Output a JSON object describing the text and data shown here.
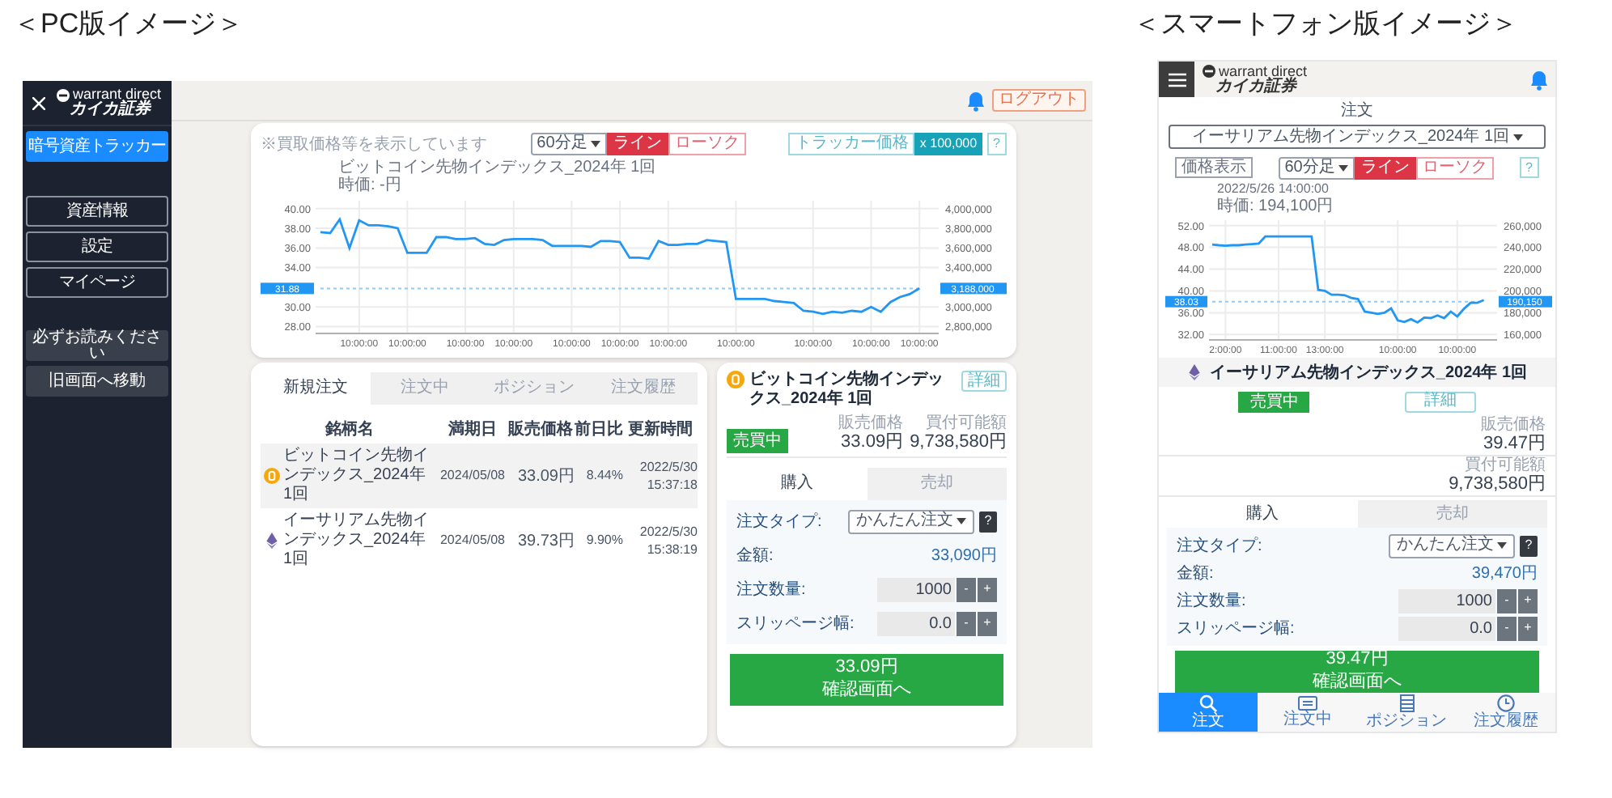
{
  "pc": {
    "caption": "＜PC版イメージ＞",
    "sidebar": {
      "brand": "warrant direct",
      "brand_sub": "カイカ証券",
      "items": [
        {
          "label": "暗号資産トラッカー",
          "selected": true
        },
        {
          "label": "資産情報",
          "selected": false
        },
        {
          "label": "設定",
          "selected": false
        },
        {
          "label": "マイページ",
          "selected": false
        }
      ],
      "links": [
        {
          "label": "必ずお読みください"
        },
        {
          "label": "旧画面へ移動"
        }
      ]
    },
    "header": {
      "logout": "ログアウト"
    },
    "chart_panel": {
      "note": "※買取価格等を表示しています",
      "interval": "60分足",
      "chart_types": [
        {
          "label": "ライン",
          "selected": true
        },
        {
          "label": "ローソク",
          "selected": false
        }
      ],
      "tracker_label": "トラッカー価格",
      "multiplier": "x 100,000",
      "help": "?",
      "title": "ビットコイン先物インデックス_2024年 1回",
      "subtitle": "時価: -円",
      "price_tag": "31.88",
      "right_price_tag": "3,188,000",
      "right_axis_ticks": [
        "4,000,000",
        "3,800,000",
        "3,600,000",
        "3,400,000",
        "3,000,000",
        "2,800,000"
      ],
      "chart_data": {
        "type": "line",
        "grid": true,
        "ylim": [
          27.3,
          40.8
        ],
        "categories": [
          null,
          null,
          null,
          null,
          "10:00:00",
          null,
          null,
          null,
          null,
          "10:00:00",
          null,
          null,
          null,
          null,
          null,
          "10:00:00",
          null,
          null,
          null,
          null,
          "10:00:00",
          null,
          null,
          null,
          null,
          null,
          "10:00:00",
          null,
          null,
          null,
          null,
          "10:00:00",
          null,
          null,
          null,
          null,
          "10:00:00",
          null,
          null,
          null,
          null,
          null,
          null,
          "10:00:00",
          null,
          null,
          null,
          null,
          null,
          null,
          null,
          "10:00:00",
          null,
          null,
          null,
          null,
          null,
          "10:00:00",
          null,
          null,
          null,
          null,
          "10:00:00"
        ],
        "yticks": [
          {
            "value": 28,
            "label": "28.00"
          },
          {
            "value": 30,
            "label": "30.00"
          },
          {
            "value": 34,
            "label": "34.00"
          },
          {
            "value": 36,
            "label": "36.00"
          },
          {
            "value": 38,
            "label": "38.00"
          },
          {
            "value": 40,
            "label": "40.00"
          }
        ],
        "series": [
          {
            "color": "#2196f3",
            "values": [
              37.6,
              37.5,
              38.9,
              36.0,
              38.8,
              38.3,
              38.3,
              38.2,
              38.0,
              35.5,
              35.5,
              35.5,
              37.1,
              37.1,
              36.9,
              36.9,
              37.0,
              36.4,
              36.3,
              36.8,
              36.9,
              36.9,
              36.9,
              36.8,
              36.2,
              36.2,
              36.2,
              36.2,
              36.1,
              36.7,
              36.7,
              36.6,
              35.0,
              35.0,
              34.9,
              36.7,
              36.3,
              36.3,
              36.4,
              36.4,
              36.8,
              36.7,
              36.6,
              30.8,
              30.8,
              30.8,
              30.8,
              30.6,
              30.5,
              30.4,
              29.6,
              29.5,
              29.3,
              29.5,
              29.4,
              29.6,
              29.5,
              30.0,
              29.5,
              30.5,
              31.0,
              31.3,
              31.9
            ]
          },
          {
            "color": "#90caf9",
            "line_style": "dashed",
            "values": [
              31.88,
              31.88,
              31.88,
              31.88,
              31.88,
              31.88,
              31.88,
              31.88,
              31.88,
              31.88,
              31.88,
              31.88,
              31.88,
              31.88,
              31.88,
              31.88,
              31.88,
              31.88,
              31.88,
              31.88,
              31.88,
              31.88,
              31.88,
              31.88,
              31.88,
              31.88,
              31.88,
              31.88,
              31.88,
              31.88,
              31.88,
              31.88,
              31.88,
              31.88,
              31.88,
              31.88,
              31.88,
              31.88,
              31.88,
              31.88,
              31.88,
              31.88,
              31.88,
              31.88,
              31.88,
              31.88,
              31.88,
              31.88,
              31.88,
              31.88,
              31.88,
              31.88,
              31.88,
              31.88,
              31.88,
              31.88,
              31.88,
              31.88,
              31.88,
              31.88,
              31.88,
              31.88,
              31.88
            ]
          }
        ]
      }
    },
    "tabs": [
      {
        "label": "新規注文",
        "selected": true
      },
      {
        "label": "注文中",
        "selected": false
      },
      {
        "label": "ポジション",
        "selected": false
      },
      {
        "label": "注文履歴",
        "selected": false
      }
    ],
    "table": {
      "columns": [
        "銘柄名",
        "満期日",
        "販売価格",
        "前日比",
        "更新時間"
      ],
      "rows": [
        {
          "kind": "btc",
          "name": "ビットコイン先物インデックス_2024年 1回",
          "maturity": "2024/05/08",
          "price": "33.09円",
          "change": "8.44%",
          "updated": "2022/5/30 15:37:18",
          "selected": true
        },
        {
          "kind": "eth",
          "name": "イーサリアム先物インデックス_2024年 1回",
          "maturity": "2024/05/08",
          "price": "39.73円",
          "change": "9.90%",
          "updated": "2022/5/30 15:38:19",
          "selected": false
        }
      ]
    },
    "order": {
      "kind": "btc",
      "title": "ビットコイン先物インデックス_2024年 1回",
      "detail": "詳細",
      "status": "売買中",
      "price_label": "販売価格",
      "price": "33.09円",
      "available_label": "買付可能額",
      "available": "9,738,580円",
      "tabs": [
        {
          "label": "購入",
          "selected": true
        },
        {
          "label": "売却",
          "selected": false
        }
      ],
      "fields": [
        {
          "kind": "select",
          "label": "注文タイプ:",
          "value": "かんたん注文",
          "help": "?"
        },
        {
          "kind": "amount",
          "label": "金額:",
          "value": "33,090円"
        },
        {
          "kind": "stepper",
          "label": "注文数量:",
          "value": "1000",
          "minus": "-",
          "plus": "+"
        },
        {
          "kind": "stepper",
          "label": "スリッページ幅:",
          "value": "0.0",
          "minus": "-",
          "plus": "+"
        }
      ],
      "submit_price": "33.09円",
      "submit_label": "確認画面へ"
    }
  },
  "phone": {
    "caption": "＜スマートフォン版イメージ＞",
    "brand": "warrant direct",
    "brand_sub": "カイカ証券",
    "section": "注文",
    "product_select": "イーサリアム先物インデックス_2024年 1回",
    "chart_panel": {
      "price_button": "価格表示",
      "interval": "60分足",
      "chart_types": [
        {
          "label": "ライン",
          "selected": true
        },
        {
          "label": "ローソク",
          "selected": false
        }
      ],
      "help": "?",
      "title": "2022/5/26 14:00:00",
      "subtitle": "時価: 194,100円",
      "price_tag": "38.03",
      "right_price_tag": "190,150",
      "right_axis_ticks": [
        "260,000",
        "240,000",
        "220,000",
        "200,000",
        "180,000",
        "160,000"
      ],
      "chart_data": {
        "type": "line",
        "grid": true,
        "ylim": [
          31,
          53
        ],
        "categories": [
          null,
          null,
          "2:00:00",
          null,
          null,
          null,
          null,
          null,
          null,
          null,
          "11:00:00",
          null,
          null,
          null,
          null,
          null,
          null,
          "13:00:00",
          null,
          null,
          null,
          null,
          null,
          null,
          null,
          null,
          null,
          null,
          "10:00:00",
          null,
          null,
          null,
          null,
          null,
          null,
          null,
          null,
          "10:00:00",
          null,
          null,
          null,
          null
        ],
        "yticks": [
          {
            "value": 32,
            "label": "32.00"
          },
          {
            "value": 36,
            "label": "36.00"
          },
          {
            "value": 40,
            "label": "40.00"
          },
          {
            "value": 44,
            "label": "44.00"
          },
          {
            "value": 48,
            "label": "48.00"
          },
          {
            "value": 52,
            "label": "52.00"
          }
        ],
        "series": [
          {
            "color": "#2196f3",
            "values": [
              48.5,
              48.4,
              48.3,
              48.4,
              48.4,
              48.5,
              48.6,
              48.7,
              50,
              50,
              50,
              50,
              50,
              50,
              50,
              50,
              40.2,
              40.0,
              39.3,
              39.3,
              39.2,
              38.7,
              38.5,
              36.2,
              36.0,
              35.8,
              36.0,
              36.8,
              34.6,
              34.3,
              34.8,
              34.2,
              35.1,
              35.0,
              35.5,
              35.0,
              36.2,
              35.3,
              36.7,
              37.8,
              37.8,
              38.3
            ]
          },
          {
            "color": "#90caf9",
            "line_style": "dashed",
            "values": [
              38.03,
              38.03,
              38.03,
              38.03,
              38.03,
              38.03,
              38.03,
              38.03,
              38.03,
              38.03,
              38.03,
              38.03,
              38.03,
              38.03,
              38.03,
              38.03,
              38.03,
              38.03,
              38.03,
              38.03,
              38.03,
              38.03,
              38.03,
              38.03,
              38.03,
              38.03,
              38.03,
              38.03,
              38.03,
              38.03,
              38.03,
              38.03,
              38.03,
              38.03,
              38.03,
              38.03,
              38.03,
              38.03,
              38.03,
              38.03,
              38.03,
              38.03
            ]
          }
        ]
      }
    },
    "order": {
      "kind": "eth",
      "title": "イーサリアム先物インデックス_2024年 1回",
      "detail": "詳細",
      "status": "売買中",
      "price_label": "販売価格",
      "price": "39.47円",
      "available_label": "買付可能額",
      "available": "9,738,580円",
      "tabs": [
        {
          "label": "購入",
          "selected": true
        },
        {
          "label": "売却",
          "selected": false
        }
      ],
      "fields": [
        {
          "kind": "select",
          "label": "注文タイプ:",
          "value": "かんたん注文",
          "help": "?"
        },
        {
          "kind": "amount",
          "label": "金額:",
          "value": "39,470円"
        },
        {
          "kind": "stepper",
          "label": "注文数量:",
          "value": "1000",
          "minus": "-",
          "plus": "+"
        },
        {
          "kind": "stepper",
          "label": "スリッページ幅:",
          "value": "0.0",
          "minus": "-",
          "plus": "+"
        }
      ],
      "submit_price": "39.47円",
      "submit_label": "確認画面へ"
    },
    "nav": [
      {
        "kind": "search",
        "label": "注文",
        "selected": true
      },
      {
        "kind": "list",
        "label": "注文中",
        "selected": false
      },
      {
        "kind": "bars",
        "label": "ポジション",
        "selected": false
      },
      {
        "kind": "clock",
        "label": "注文履歴",
        "selected": false
      }
    ]
  }
}
